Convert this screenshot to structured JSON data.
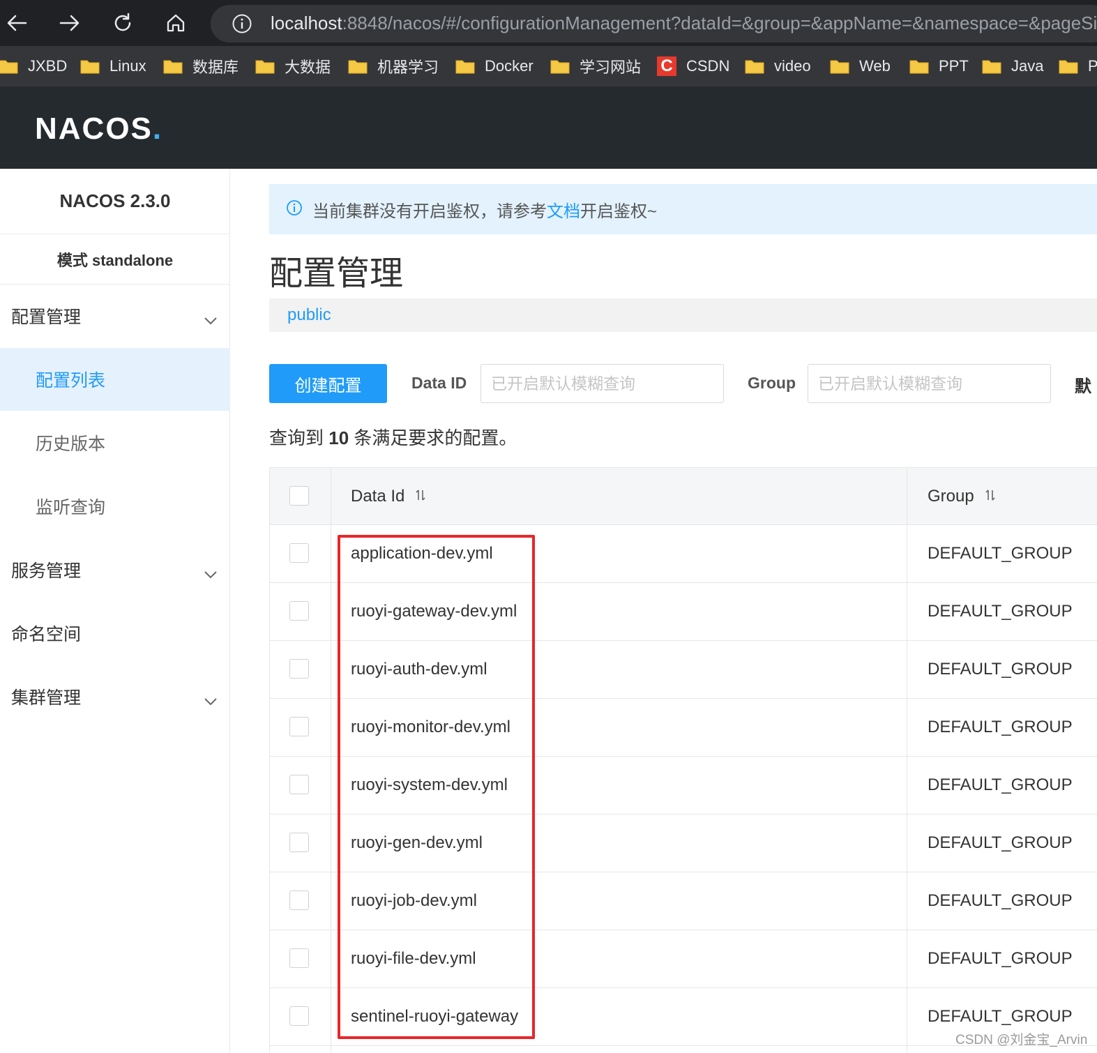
{
  "browser": {
    "url_host": "localhost",
    "url_rest": ":8848/nacos/#/configurationManagement?dataId=&group=&appName=&namespace=&pageSize=",
    "bookmarks": [
      {
        "label": "JXBD",
        "icon": "folder-icon"
      },
      {
        "label": "Linux",
        "icon": "folder-icon"
      },
      {
        "label": "数据库",
        "icon": "folder-icon"
      },
      {
        "label": "大数据",
        "icon": "folder-icon"
      },
      {
        "label": "机器学习",
        "icon": "folder-icon"
      },
      {
        "label": "Docker",
        "icon": "folder-icon"
      },
      {
        "label": "学习网站",
        "icon": "folder-icon"
      },
      {
        "label": "CSDN",
        "icon": "csdn-icon"
      },
      {
        "label": "video",
        "icon": "folder-icon"
      },
      {
        "label": "Web",
        "icon": "folder-icon"
      },
      {
        "label": "PPT",
        "icon": "folder-icon"
      },
      {
        "label": "Java",
        "icon": "folder-icon"
      },
      {
        "label": "P",
        "icon": "folder-icon"
      }
    ],
    "csdn_badge": "C"
  },
  "header": {
    "logo_main": "NACOS",
    "logo_dot": "."
  },
  "sidebar": {
    "version": "NACOS 2.3.0",
    "mode": "模式 standalone",
    "items": [
      {
        "label": "配置管理"
      },
      {
        "label": "配置列表"
      },
      {
        "label": "历史版本"
      },
      {
        "label": "监听查询"
      },
      {
        "label": "服务管理"
      },
      {
        "label": "命名空间"
      },
      {
        "label": "集群管理"
      }
    ]
  },
  "notice": {
    "before": "当前集群没有开启鉴权，请参考",
    "link": "文档",
    "after": "开启鉴权~"
  },
  "main": {
    "title": "配置管理",
    "namespace": "public",
    "create_button": "创建配置",
    "filter_dataid_label": "Data ID",
    "filter_dataid_placeholder": "已开启默认模糊查询",
    "filter_group_label": "Group",
    "filter_group_placeholder": "已开启默认模糊查询",
    "filter_extra": "默",
    "summary_before": "查询到 ",
    "summary_count": "10",
    "summary_after": " 条满足要求的配置。"
  },
  "table": {
    "headers": {
      "data_id": "Data Id",
      "group": "Group"
    },
    "rows": [
      {
        "data_id": "application-dev.yml",
        "group": "DEFAULT_GROUP"
      },
      {
        "data_id": "ruoyi-gateway-dev.yml",
        "group": "DEFAULT_GROUP"
      },
      {
        "data_id": "ruoyi-auth-dev.yml",
        "group": "DEFAULT_GROUP"
      },
      {
        "data_id": "ruoyi-monitor-dev.yml",
        "group": "DEFAULT_GROUP"
      },
      {
        "data_id": "ruoyi-system-dev.yml",
        "group": "DEFAULT_GROUP"
      },
      {
        "data_id": "ruoyi-gen-dev.yml",
        "group": "DEFAULT_GROUP"
      },
      {
        "data_id": "ruoyi-job-dev.yml",
        "group": "DEFAULT_GROUP"
      },
      {
        "data_id": "ruoyi-file-dev.yml",
        "group": "DEFAULT_GROUP"
      },
      {
        "data_id": "sentinel-ruoyi-gateway",
        "group": "DEFAULT_GROUP"
      }
    ]
  },
  "watermark": "CSDN @刘金宝_Arvin",
  "colors": {
    "accent": "#209bfa",
    "highlight": "#e8262a",
    "header_bg": "#252a2f"
  }
}
